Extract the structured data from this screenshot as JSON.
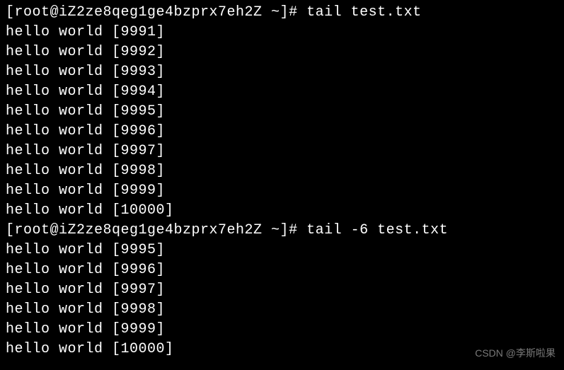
{
  "commands": [
    {
      "prompt": "[root@iZ2ze8qeg1ge4bzprx7eh2Z ~]# ",
      "command": "tail test.txt",
      "output": [
        "hello world [9991]",
        "hello world [9992]",
        "hello world [9993]",
        "hello world [9994]",
        "hello world [9995]",
        "hello world [9996]",
        "hello world [9997]",
        "hello world [9998]",
        "hello world [9999]",
        "hello world [10000]"
      ]
    },
    {
      "prompt": "[root@iZ2ze8qeg1ge4bzprx7eh2Z ~]# ",
      "command": "tail -6 test.txt",
      "output": [
        "hello world [9995]",
        "hello world [9996]",
        "hello world [9997]",
        "hello world [9998]",
        "hello world [9999]",
        "hello world [10000]"
      ]
    }
  ],
  "watermark": "CSDN @李斯啦果"
}
